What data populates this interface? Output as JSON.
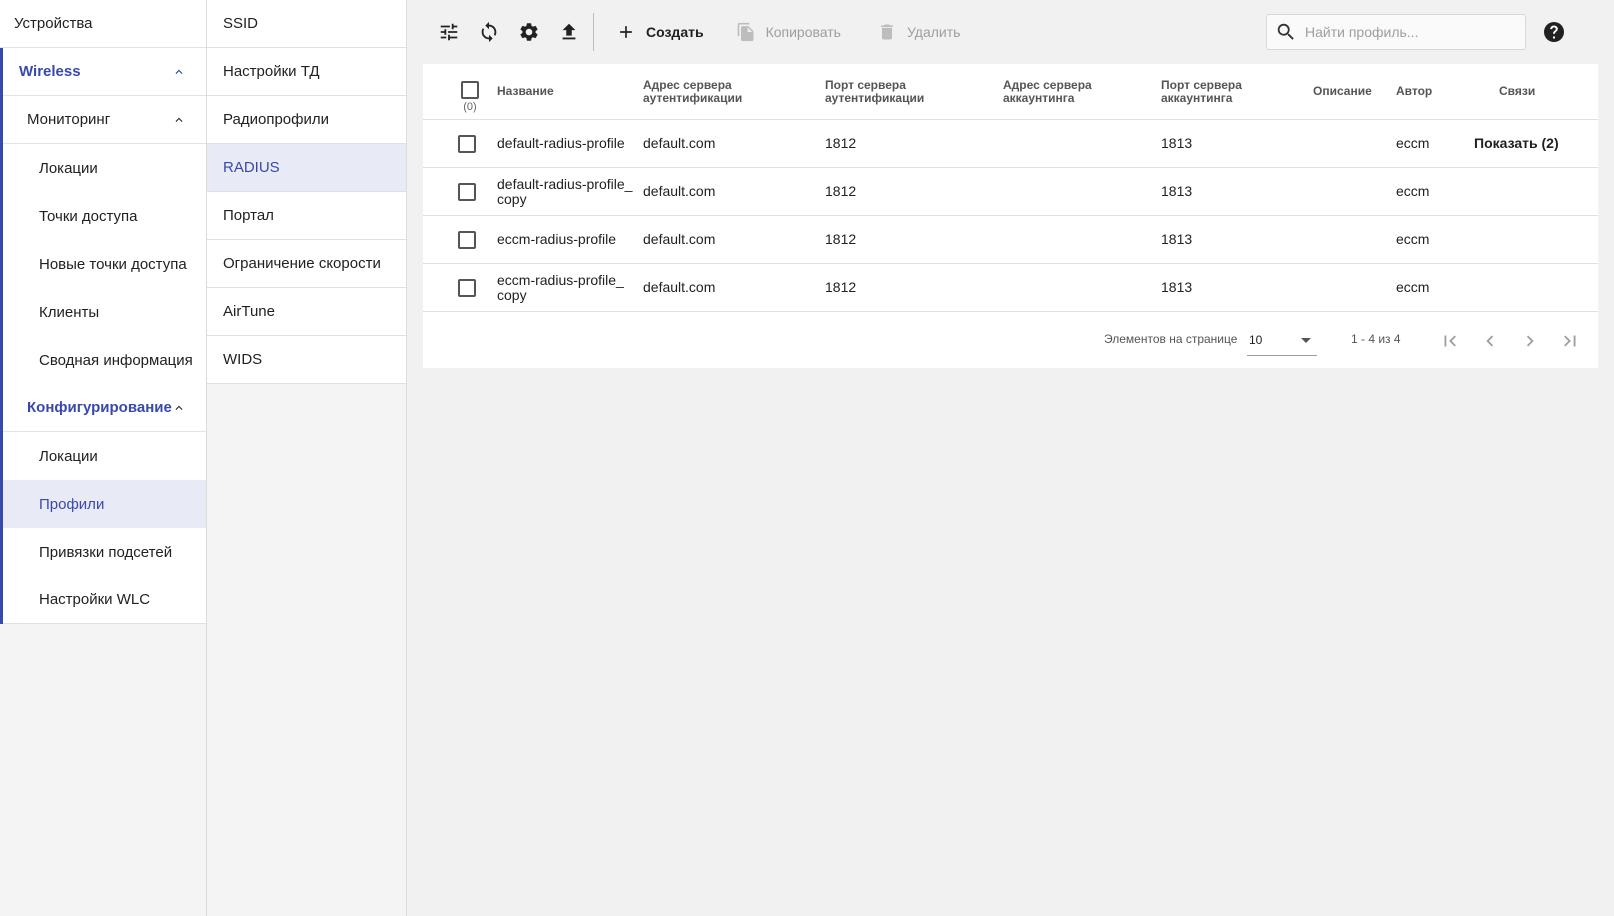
{
  "nav": {
    "devices": "Устройства",
    "wireless": "Wireless",
    "monitoring": "Мониторинг",
    "monitoring_items": [
      "Локации",
      "Точки доступа",
      "Новые точки доступа",
      "Клиенты",
      "Сводная информация"
    ],
    "configuration": "Конфигурирование",
    "configuration_items": [
      "Локации",
      "Профили",
      "Привязки подсетей",
      "Настройки WLC"
    ],
    "active_item": "Профили"
  },
  "subnav": {
    "items": [
      "SSID",
      "Настройки ТД",
      "Радиопрофили",
      "RADIUS",
      "Портал",
      "Ограничение скорости",
      "AirTune",
      "WIDS"
    ],
    "active_item": "RADIUS"
  },
  "toolbar": {
    "icons": [
      "filter-settings-icon",
      "refresh-icon",
      "gear-icon",
      "upload-icon"
    ],
    "create_label": "Создать",
    "copy_label": "Копировать",
    "delete_label": "Удалить"
  },
  "search": {
    "placeholder": "Найти профиль..."
  },
  "table": {
    "selected_count": "(0)",
    "columns": [
      "Название",
      "Адрес сервера аутентификации",
      "Порт сервера аутентификации",
      "Адрес сервера аккаунтинга",
      "Порт сервера аккаунтинга",
      "Описание",
      "Автор",
      "Связи"
    ],
    "rows": [
      {
        "name": "default-radius-profile",
        "auth_addr": "default.com",
        "auth_port": "1812",
        "acct_addr": "",
        "acct_port": "1813",
        "desc": "",
        "author": "eccm",
        "links": "Показать (2)"
      },
      {
        "name": "default-radius-profile_\ncopy",
        "auth_addr": "default.com",
        "auth_port": "1812",
        "acct_addr": "",
        "acct_port": "1813",
        "desc": "",
        "author": "eccm",
        "links": ""
      },
      {
        "name": "eccm-radius-profile",
        "auth_addr": "default.com",
        "auth_port": "1812",
        "acct_addr": "",
        "acct_port": "1813",
        "desc": "",
        "author": "eccm",
        "links": ""
      },
      {
        "name": "eccm-radius-profile_\ncopy",
        "auth_addr": "default.com",
        "auth_port": "1812",
        "acct_addr": "",
        "acct_port": "1813",
        "desc": "",
        "author": "eccm",
        "links": ""
      }
    ]
  },
  "pager": {
    "items_per_page_label": "Элементов на странице",
    "page_size": "10",
    "range": "1 - 4 из 4"
  },
  "colors": {
    "accent": "#3949ab",
    "active_bg": "#e8eaf6"
  }
}
